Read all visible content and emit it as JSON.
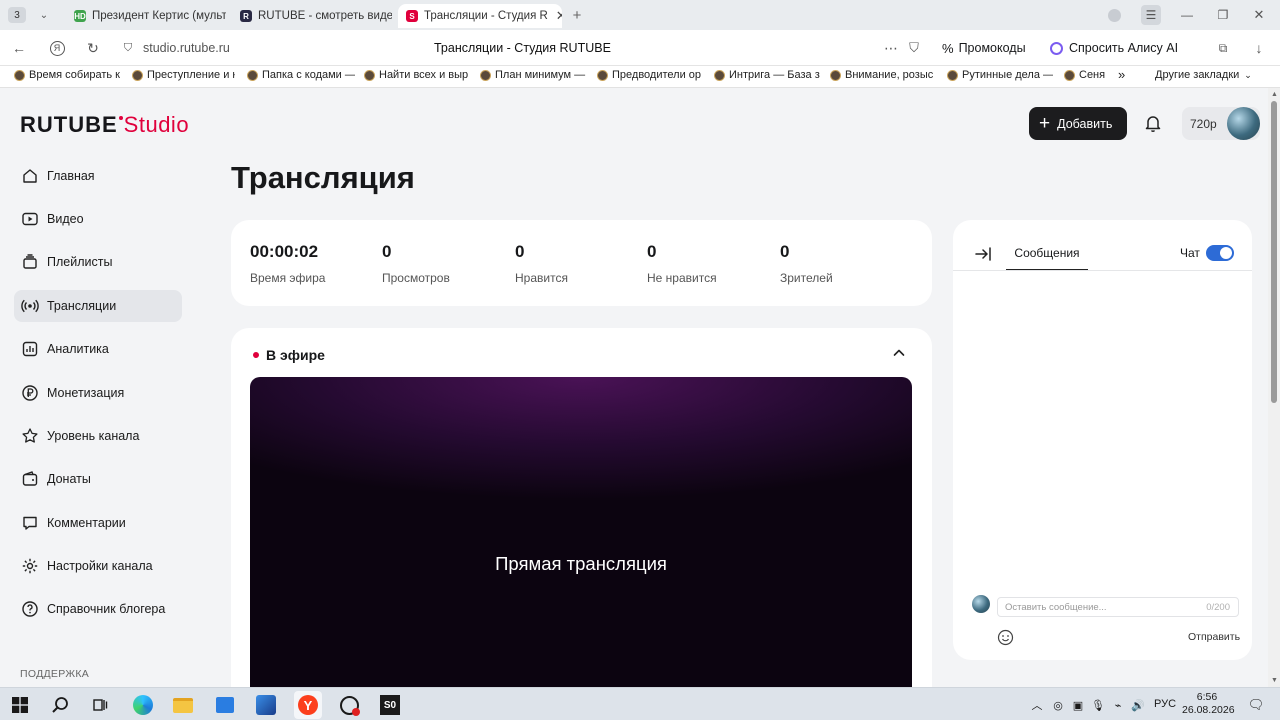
{
  "browser": {
    "tab_counter": "3",
    "tabs": [
      {
        "title": "Президент Кертис (мульт",
        "icon": "hd-icon"
      },
      {
        "title": "RUTUBE - смотреть виде",
        "icon": "rutube-icon"
      },
      {
        "title": "Трансляции - Студия R",
        "icon": "rutube-studio-icon"
      }
    ],
    "url": "studio.rutube.ru",
    "page_title": "Трансляции - Студия RUTUBE",
    "promo_label": "Промокоды",
    "alice_label": "Спросить Алису AI",
    "bookmarks": [
      "Время собирать к",
      "Преступление и н",
      "Папка с кодами —",
      "Найти всех и выр",
      "План минимум —",
      "Предводители ор",
      "Интрига — База з",
      "Внимание, розыс",
      "Рутинные дела —",
      "Сеня"
    ],
    "bookmarks_more": "»",
    "other_bookmarks": "Другие закладки"
  },
  "header": {
    "logo_main": "RUTUBE",
    "logo_sub": "Studio",
    "add_label": "Добавить",
    "quality": "720p"
  },
  "sidebar": {
    "items": [
      {
        "label": "Главная",
        "icon": "home-icon"
      },
      {
        "label": "Видео",
        "icon": "video-icon"
      },
      {
        "label": "Плейлисты",
        "icon": "playlist-icon"
      },
      {
        "label": "Трансляции",
        "icon": "broadcast-icon"
      },
      {
        "label": "Аналитика",
        "icon": "analytics-icon"
      },
      {
        "label": "Монетизация",
        "icon": "ruble-icon"
      },
      {
        "label": "Уровень канала",
        "icon": "star-icon"
      },
      {
        "label": "Донаты",
        "icon": "wallet-icon"
      },
      {
        "label": "Комментарии",
        "icon": "comment-icon"
      },
      {
        "label": "Настройки канала",
        "icon": "gear-icon"
      },
      {
        "label": "Справочник блогера",
        "icon": "help-icon"
      }
    ],
    "support_label": "ПОДДЕРЖКА"
  },
  "main": {
    "title": "Трансляция",
    "stats": [
      {
        "value": "00:00:02",
        "label": "Время эфира"
      },
      {
        "value": "0",
        "label": "Просмотров"
      },
      {
        "value": "0",
        "label": "Нравится"
      },
      {
        "value": "0",
        "label": "Не нравится"
      },
      {
        "value": "0",
        "label": "Зрителей"
      }
    ],
    "live_label": "В эфире",
    "player_text": "Прямая трансляция"
  },
  "chat": {
    "tab_label": "Сообщения",
    "toggle_label": "Чат",
    "toggle_on": true,
    "input_placeholder": "Оставить сообщение...",
    "counter": "0/200",
    "send_label": "Отправить"
  },
  "taskbar": {
    "lang": "РУС",
    "time": "6:56",
    "date": "26.08.2026"
  },
  "colors": {
    "accent": "#e0003c",
    "dark": "#1c1c1e",
    "toggle": "#2d6bd6"
  }
}
